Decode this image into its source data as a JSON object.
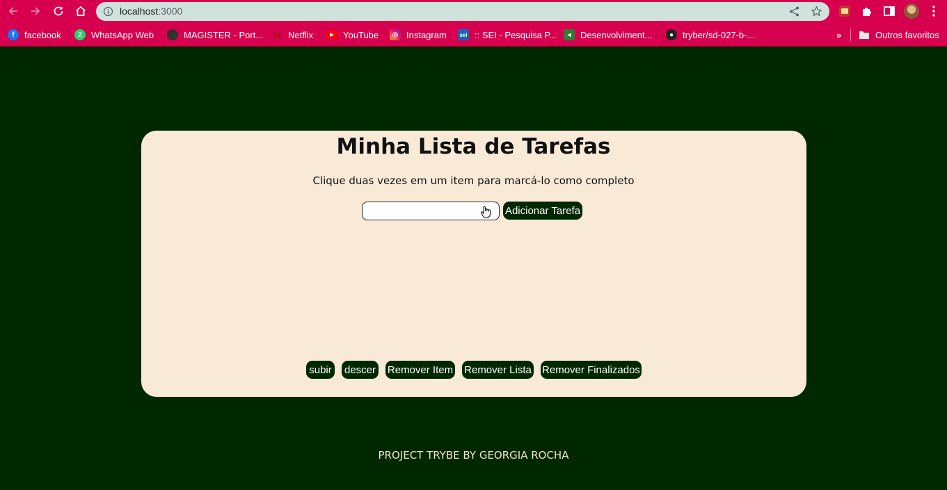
{
  "browser": {
    "url_host": "localhost",
    "url_port": ":3000",
    "bookmarks": [
      {
        "label": "facebook"
      },
      {
        "label": "WhatsApp Web"
      },
      {
        "label": "MAGISTER - Port..."
      },
      {
        "label": "Netflix"
      },
      {
        "label": "YouTube"
      },
      {
        "label": "Instagram"
      },
      {
        "label": ":: SEI - Pesquisa P..."
      },
      {
        "label": "Desenvolviment..."
      },
      {
        "label": "tryber/sd-027-b-..."
      }
    ],
    "other_bookmarks": "Outros favoritos",
    "chrome_color": "#d6004f",
    "omnibox_color": "#cfe3dc"
  },
  "page": {
    "title": "Minha Lista de Tarefas",
    "subtitle": "Clique duas vezes em um item para marcá-lo como completo",
    "input_value": "",
    "add_button": "Adicionar Tarefa",
    "tasks": [],
    "controls": {
      "up": "subir",
      "down": "descer",
      "remove_item": "Remover Item",
      "remove_list": "Remover Lista",
      "remove_done": "Remover Finalizados"
    },
    "footer": "PROJECT TRYBE BY GEORGIA ROCHA",
    "colors": {
      "background": "#002800",
      "card": "#f9ead8",
      "button": "#002800",
      "footer_text": "#f3e4c8"
    }
  }
}
